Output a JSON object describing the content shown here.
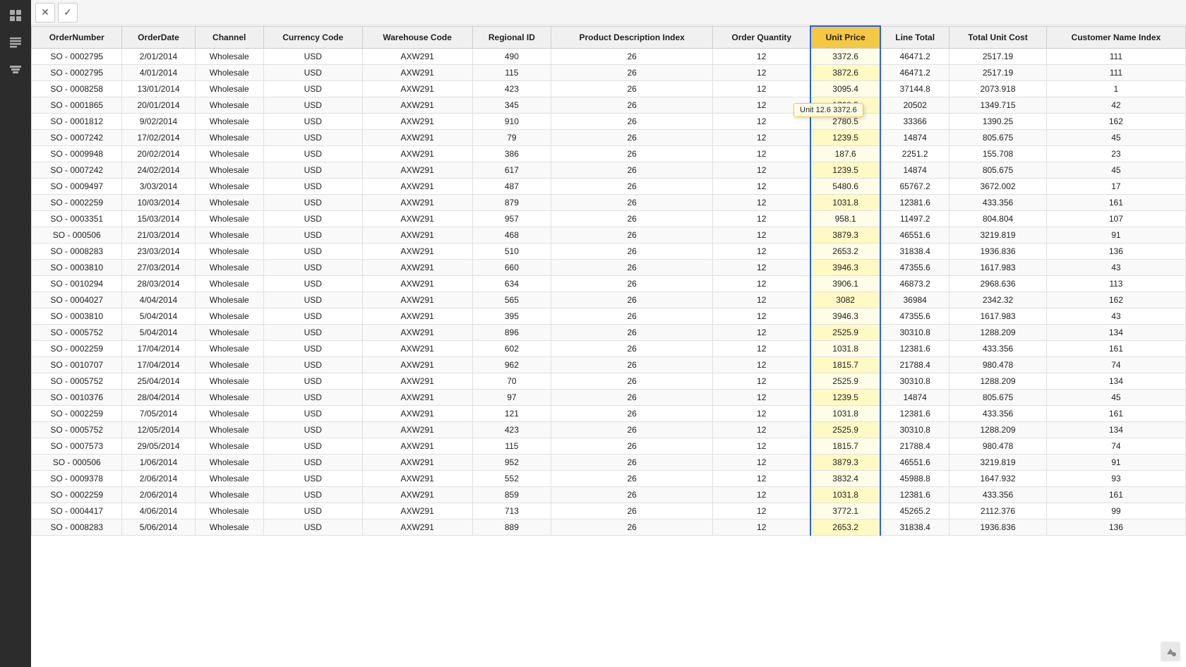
{
  "toolbar": {
    "close_label": "✕",
    "confirm_label": "✓"
  },
  "table": {
    "columns": [
      "OrderNumber",
      "OrderDate",
      "Channel",
      "Currency Code",
      "Warehouse Code",
      "Regional ID",
      "Product Description Index",
      "Order Quantity",
      "Unit Price",
      "Line Total",
      "Total Unit Cost",
      "Customer Name Index"
    ],
    "active_column": "Unit Price",
    "tooltip": "Unit 12.6  3372.6",
    "rows": [
      [
        "SO - 0002795",
        "2/01/2014",
        "Wholesale",
        "USD",
        "AXW291",
        "490",
        "26",
        "12",
        "3372.6",
        "46471.2",
        "2517.19",
        "111"
      ],
      [
        "SO - 0002795",
        "4/01/2014",
        "Wholesale",
        "USD",
        "AXW291",
        "115",
        "26",
        "12",
        "3872.6",
        "46471.2",
        "2517.19",
        "111"
      ],
      [
        "SO - 0008258",
        "13/01/2014",
        "Wholesale",
        "USD",
        "AXW291",
        "423",
        "26",
        "12",
        "3095.4",
        "37144.8",
        "2073.918",
        "1"
      ],
      [
        "SO - 0001865",
        "20/01/2014",
        "Wholesale",
        "USD",
        "AXW291",
        "345",
        "26",
        "12",
        "1708.5",
        "20502",
        "1349.715",
        "42"
      ],
      [
        "SO - 0001812",
        "9/02/2014",
        "Wholesale",
        "USD",
        "AXW291",
        "910",
        "26",
        "12",
        "2780.5",
        "33366",
        "1390.25",
        "162"
      ],
      [
        "SO - 0007242",
        "17/02/2014",
        "Wholesale",
        "USD",
        "AXW291",
        "79",
        "26",
        "12",
        "1239.5",
        "14874",
        "805.675",
        "45"
      ],
      [
        "SO - 0009948",
        "20/02/2014",
        "Wholesale",
        "USD",
        "AXW291",
        "386",
        "26",
        "12",
        "187.6",
        "2251.2",
        "155.708",
        "23"
      ],
      [
        "SO - 0007242",
        "24/02/2014",
        "Wholesale",
        "USD",
        "AXW291",
        "617",
        "26",
        "12",
        "1239.5",
        "14874",
        "805.675",
        "45"
      ],
      [
        "SO - 0009497",
        "3/03/2014",
        "Wholesale",
        "USD",
        "AXW291",
        "487",
        "26",
        "12",
        "5480.6",
        "65767.2",
        "3672.002",
        "17"
      ],
      [
        "SO - 0002259",
        "10/03/2014",
        "Wholesale",
        "USD",
        "AXW291",
        "879",
        "26",
        "12",
        "1031.8",
        "12381.6",
        "433.356",
        "161"
      ],
      [
        "SO - 0003351",
        "15/03/2014",
        "Wholesale",
        "USD",
        "AXW291",
        "957",
        "26",
        "12",
        "958.1",
        "11497.2",
        "804.804",
        "107"
      ],
      [
        "SO - 000506",
        "21/03/2014",
        "Wholesale",
        "USD",
        "AXW291",
        "468",
        "26",
        "12",
        "3879.3",
        "46551.6",
        "3219.819",
        "91"
      ],
      [
        "SO - 0008283",
        "23/03/2014",
        "Wholesale",
        "USD",
        "AXW291",
        "510",
        "26",
        "12",
        "2653.2",
        "31838.4",
        "1936.836",
        "136"
      ],
      [
        "SO - 0003810",
        "27/03/2014",
        "Wholesale",
        "USD",
        "AXW291",
        "660",
        "26",
        "12",
        "3946.3",
        "47355.6",
        "1617.983",
        "43"
      ],
      [
        "SO - 0010294",
        "28/03/2014",
        "Wholesale",
        "USD",
        "AXW291",
        "634",
        "26",
        "12",
        "3906.1",
        "46873.2",
        "2968.636",
        "113"
      ],
      [
        "SO - 0004027",
        "4/04/2014",
        "Wholesale",
        "USD",
        "AXW291",
        "565",
        "26",
        "12",
        "3082",
        "36984",
        "2342.32",
        "162"
      ],
      [
        "SO - 0003810",
        "5/04/2014",
        "Wholesale",
        "USD",
        "AXW291",
        "395",
        "26",
        "12",
        "3946.3",
        "47355.6",
        "1617.983",
        "43"
      ],
      [
        "SO - 0005752",
        "5/04/2014",
        "Wholesale",
        "USD",
        "AXW291",
        "896",
        "26",
        "12",
        "2525.9",
        "30310.8",
        "1288.209",
        "134"
      ],
      [
        "SO - 0002259",
        "17/04/2014",
        "Wholesale",
        "USD",
        "AXW291",
        "602",
        "26",
        "12",
        "1031.8",
        "12381.6",
        "433.356",
        "161"
      ],
      [
        "SO - 0010707",
        "17/04/2014",
        "Wholesale",
        "USD",
        "AXW291",
        "962",
        "26",
        "12",
        "1815.7",
        "21788.4",
        "980.478",
        "74"
      ],
      [
        "SO - 0005752",
        "25/04/2014",
        "Wholesale",
        "USD",
        "AXW291",
        "70",
        "26",
        "12",
        "2525.9",
        "30310.8",
        "1288.209",
        "134"
      ],
      [
        "SO - 0010376",
        "28/04/2014",
        "Wholesale",
        "USD",
        "AXW291",
        "97",
        "26",
        "12",
        "1239.5",
        "14874",
        "805.675",
        "45"
      ],
      [
        "SO - 0002259",
        "7/05/2014",
        "Wholesale",
        "USD",
        "AXW291",
        "121",
        "26",
        "12",
        "1031.8",
        "12381.6",
        "433.356",
        "161"
      ],
      [
        "SO - 0005752",
        "12/05/2014",
        "Wholesale",
        "USD",
        "AXW291",
        "423",
        "26",
        "12",
        "2525.9",
        "30310.8",
        "1288.209",
        "134"
      ],
      [
        "SO - 0007573",
        "29/05/2014",
        "Wholesale",
        "USD",
        "AXW291",
        "115",
        "26",
        "12",
        "1815.7",
        "21788.4",
        "980.478",
        "74"
      ],
      [
        "SO - 000506",
        "1/06/2014",
        "Wholesale",
        "USD",
        "AXW291",
        "952",
        "26",
        "12",
        "3879.3",
        "46551.6",
        "3219.819",
        "91"
      ],
      [
        "SO - 0009378",
        "2/06/2014",
        "Wholesale",
        "USD",
        "AXW291",
        "552",
        "26",
        "12",
        "3832.4",
        "45988.8",
        "1647.932",
        "93"
      ],
      [
        "SO - 0002259",
        "2/06/2014",
        "Wholesale",
        "USD",
        "AXW291",
        "859",
        "26",
        "12",
        "1031.8",
        "12381.6",
        "433.356",
        "161"
      ],
      [
        "SO - 0004417",
        "4/06/2014",
        "Wholesale",
        "USD",
        "AXW291",
        "713",
        "26",
        "12",
        "3772.1",
        "45265.2",
        "2112.376",
        "99"
      ],
      [
        "SO - 0008283",
        "5/06/2014",
        "Wholesale",
        "USD",
        "AXW291",
        "889",
        "26",
        "12",
        "2653.2",
        "31838.4",
        "1936.836",
        "136"
      ]
    ]
  },
  "icons": {
    "close": "✕",
    "confirm": "✓",
    "grid": "⊞",
    "table": "☰",
    "chart": "📊",
    "cursor_arrow": "↖"
  }
}
